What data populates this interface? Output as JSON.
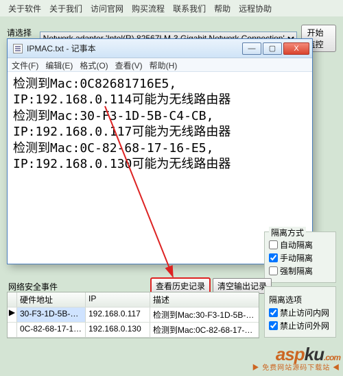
{
  "bg_menu": [
    "关于软件",
    "关于我们",
    "访问官网",
    "购买流程",
    "联系我们",
    "帮助",
    "远程协助"
  ],
  "adapter": {
    "label": "请选择网卡",
    "value": "Network adapter 'Intel(R) 82567LM-3 Gigabit Network Connection'",
    "start_btn": "开始监控"
  },
  "notepad": {
    "title": "IPMAC.txt - 记事本",
    "menu": [
      "文件(F)",
      "编辑(E)",
      "格式(O)",
      "查看(V)",
      "帮助(H)"
    ],
    "content": "检测到Mac:0C82681716E5,\nIP:192.168.0.114可能为无线路由器\n检测到Mac:30-F3-1D-5B-C4-CB,\nIP:192.168.0.117可能为无线路由器\n检测到Mac:0C-82-68-17-16-E5,\nIP:192.168.0.130可能为无线路由器",
    "win_btns": {
      "min": "—",
      "max": "▢",
      "close": "X"
    }
  },
  "isolation": {
    "title": "隔离方式",
    "auto": "自动隔离",
    "manual": "手动隔离",
    "force": "强制隔离",
    "auto_checked": false,
    "manual_checked": true,
    "force_checked": false
  },
  "events": {
    "label": "网络安全事件",
    "view_history": "查看历史记录",
    "clear_output": "清空输出记录"
  },
  "iso_opts": {
    "title": "隔离选项",
    "intranet": "禁止访问内网",
    "extranet": "禁止访问外网",
    "in_checked": true,
    "ex_checked": true
  },
  "table": {
    "cols": [
      "",
      "硬件地址",
      "IP",
      "描述"
    ],
    "rows": [
      {
        "mark": "▶",
        "mac": "30-F3-1D-5B-C…",
        "ip": "192.168.0.117",
        "desc": "检测到Mac:30-F3-1D-5B-C4-CB,…",
        "sel": true
      },
      {
        "mark": "",
        "mac": "0C-82-68-17-1…",
        "ip": "192.168.0.130",
        "desc": "检测到Mac:0C-82-68-17-16-E5,…",
        "sel": false
      }
    ]
  },
  "brand": {
    "name_a": "asp",
    "name_b": "ku",
    "dot": ".com",
    "sub": "免费网站源码下载站"
  }
}
